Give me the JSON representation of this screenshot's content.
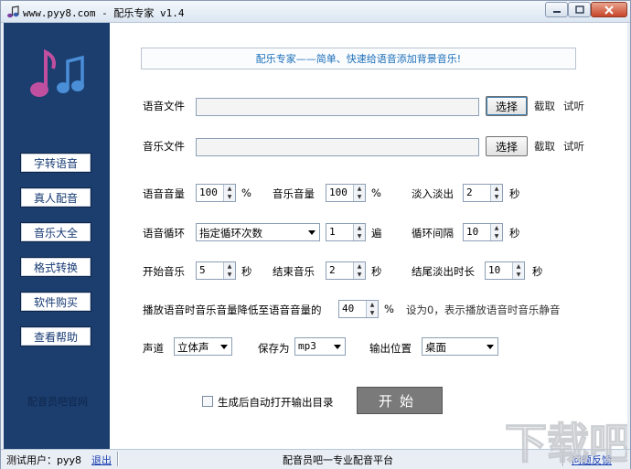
{
  "window": {
    "title": "www.pyy8.com - 配乐专家 v1.4",
    "title_icon": "music-note-icon"
  },
  "sidebar": {
    "logo_icon": "music-notes-icon",
    "items": [
      {
        "label": "字转语音"
      },
      {
        "label": "真人配音"
      },
      {
        "label": "音乐大全"
      },
      {
        "label": "格式转换"
      },
      {
        "label": "软件购买"
      },
      {
        "label": "查看帮助"
      }
    ],
    "footer": "配音员吧官网"
  },
  "banner": "配乐专家——简单、快速给语音添加背景音乐!",
  "voice_file": {
    "label": "语音文件",
    "value": "",
    "select_label": "选择",
    "cut_label": "截取",
    "listen_label": "试听"
  },
  "music_file": {
    "label": "音乐文件",
    "value": "",
    "select_label": "选择",
    "cut_label": "截取",
    "listen_label": "试听"
  },
  "voice_volume": {
    "label": "语音音量",
    "value": "100",
    "unit": "%"
  },
  "music_volume": {
    "label": "音乐音量",
    "value": "100",
    "unit": "%"
  },
  "fade_in_out": {
    "label": "淡入淡出",
    "value": "2",
    "unit": "秒"
  },
  "voice_loop": {
    "label": "语音循环",
    "mode": "指定循环次数",
    "count": "1",
    "unit": "遍"
  },
  "loop_interval": {
    "label": "循环间隔",
    "value": "10",
    "unit": "秒"
  },
  "start_music": {
    "label": "开始音乐",
    "value": "5",
    "unit": "秒"
  },
  "end_music": {
    "label": "结束音乐",
    "value": "2",
    "unit": "秒"
  },
  "tail_fade": {
    "label": "结尾淡出时长",
    "value": "10",
    "unit": "秒"
  },
  "duck": {
    "label": "播放语音时音乐音量降低至语音音量的",
    "value": "40",
    "unit": "%",
    "hint": "设为0，表示播放语音时音乐静音"
  },
  "channel": {
    "label": "声道",
    "value": "立体声"
  },
  "save_as": {
    "label": "保存为",
    "value": "mp3"
  },
  "output": {
    "label": "输出位置",
    "value": "桌面"
  },
  "auto_open": {
    "label": "生成后自动打开输出目录",
    "checked": false
  },
  "start_button": "开始",
  "statusbar": {
    "user": "测试用户：pyy8",
    "logout": "退出",
    "center": "配音员吧一专业配音平台",
    "feedback": "问题反馈"
  },
  "watermark": {
    "text": "下载吧"
  }
}
